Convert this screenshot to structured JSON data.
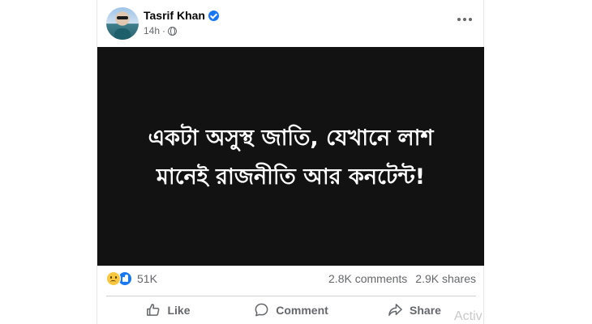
{
  "post": {
    "author": "Tasrif Khan",
    "time": "14h",
    "separator": "·",
    "image_text": "একটা অসুস্থ জাতি, যেখানে লাশ মানেই রাজনীতি আর কনটেন্ট!",
    "reaction_count": "51K",
    "comments": "2.8K comments",
    "shares": "2.9K shares"
  },
  "actions": {
    "like": "Like",
    "comment": "Comment",
    "share": "Share"
  },
  "overlay": {
    "activate_text": "Activ"
  },
  "icons": {
    "verified": "verified-badge-icon",
    "privacy": "globe-icon",
    "more": "more-options-icon",
    "reactions": [
      "sad-reaction-icon",
      "like-reaction-icon"
    ]
  },
  "colors": {
    "accent": "#1877f2",
    "image_bg": "#121212",
    "secondary_text": "#65676b"
  }
}
